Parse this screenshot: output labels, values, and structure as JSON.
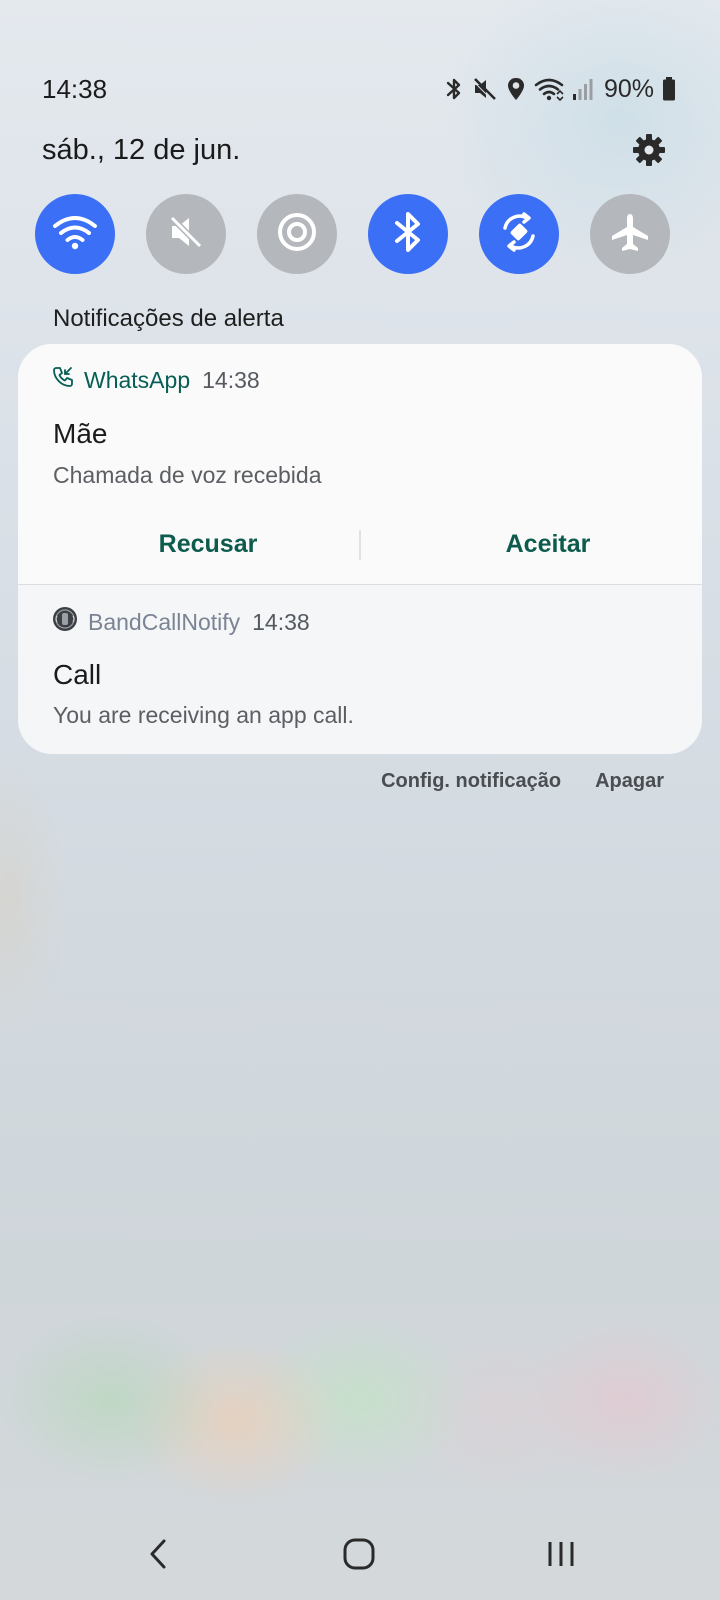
{
  "status_bar": {
    "time": "14:38",
    "icons": [
      "bluetooth-icon",
      "mute-icon",
      "location-icon",
      "wifi-icon",
      "signal-icon",
      "battery-icon"
    ],
    "battery": "90%"
  },
  "header": {
    "date": "sáb., 12 de jun.",
    "settings_icon": "gear-icon"
  },
  "quick_toggles": [
    {
      "name": "wifi",
      "icon": "wifi-icon",
      "state": "on"
    },
    {
      "name": "sound",
      "icon": "mute-icon",
      "state": "off"
    },
    {
      "name": "location",
      "icon": "target-icon",
      "state": "off"
    },
    {
      "name": "bluetooth",
      "icon": "bluetooth-icon",
      "state": "on"
    },
    {
      "name": "auto-rotate",
      "icon": "rotate-icon",
      "state": "on"
    },
    {
      "name": "airplane",
      "icon": "airplane-icon",
      "state": "off"
    }
  ],
  "section_label": "Notificações de alerta",
  "notifications": [
    {
      "app": "WhatsApp",
      "time": "14:38",
      "title": "Mãe",
      "text": "Chamada de voz recebida",
      "actions": [
        "Recusar",
        "Aceitar"
      ]
    },
    {
      "app": "BandCallNotify",
      "time": "14:38",
      "title": "Call",
      "text": "You are receiving an app call."
    }
  ],
  "footer": {
    "settings_label": "Config. notificação",
    "clear_label": "Apagar"
  },
  "nav": [
    "back-icon",
    "home-icon",
    "recents-icon"
  ],
  "colors": {
    "toggle_on": "#3b6ff5",
    "toggle_off": "#b4b8bc",
    "whatsapp_green": "#075e54"
  }
}
